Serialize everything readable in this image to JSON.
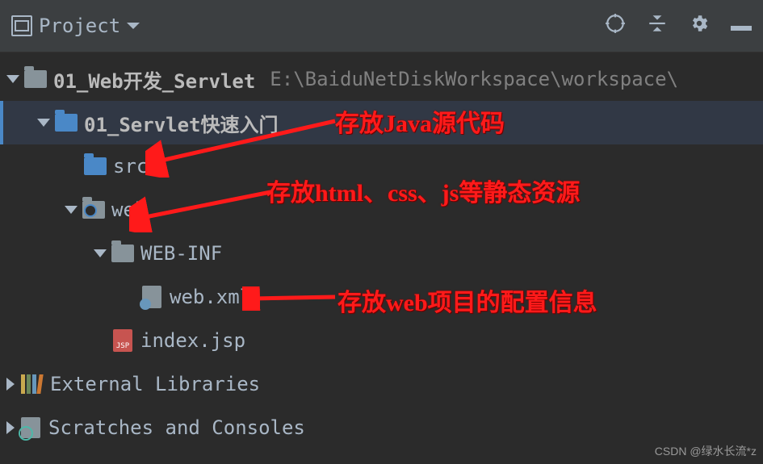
{
  "header": {
    "title": "Project"
  },
  "tree": {
    "root": {
      "name": "01_Web开发_Servlet",
      "path": "E:\\BaiduNetDiskWorkspace\\workspace\\"
    },
    "module": {
      "name": "01_Servlet快速入门"
    },
    "src": {
      "name": "src"
    },
    "web": {
      "name": "web"
    },
    "webinf": {
      "name": "WEB-INF"
    },
    "webxml": {
      "name": "web.xml"
    },
    "indexjsp": {
      "name": "index.jsp"
    },
    "extlib": {
      "name": "External Libraries"
    },
    "scratch": {
      "name": "Scratches and Consoles"
    }
  },
  "annotations": {
    "a1": "存放Java源代码",
    "a2": "存放html、css、js等静态资源",
    "a3": "存放web项目的配置信息"
  },
  "watermark": "CSDN @绿水长流*z"
}
